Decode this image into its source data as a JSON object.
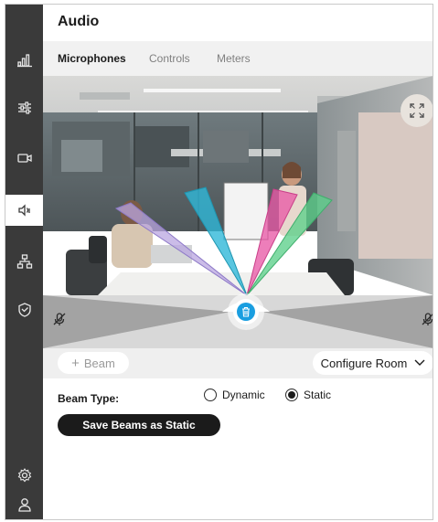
{
  "app": {
    "title": "Audio"
  },
  "tabs": [
    {
      "label": "Microphones",
      "active": true
    },
    {
      "label": "Controls",
      "active": false
    },
    {
      "label": "Meters",
      "active": false
    }
  ],
  "sidebar": {
    "items": [
      {
        "icon": "signal-bars-icon",
        "active": false
      },
      {
        "icon": "sliders-icon",
        "active": false
      },
      {
        "icon": "video-camera-icon",
        "active": false
      },
      {
        "icon": "speaker-icon",
        "active": true
      },
      {
        "icon": "network-icon",
        "active": false
      },
      {
        "icon": "shield-icon",
        "active": false
      },
      {
        "icon": "gear-icon",
        "active": false
      },
      {
        "icon": "user-icon",
        "active": false
      }
    ]
  },
  "camera": {
    "beams": [
      {
        "color": "#b9a6e0"
      },
      {
        "color": "#2fb8d8"
      },
      {
        "color": "#e85aa6"
      },
      {
        "color": "#5cd08a"
      }
    ]
  },
  "controls": {
    "beam_label": "Beam",
    "configure_label": "Configure Room"
  },
  "beam_type": {
    "label": "Beam Type:",
    "options": [
      {
        "label": "Dynamic",
        "selected": false
      },
      {
        "label": "Static",
        "selected": true
      }
    ]
  },
  "save_button": {
    "label": "Save Beams as Static"
  },
  "colors": {
    "sidebar": "#3a3a3a",
    "accent": "#1a9ee0",
    "button_dark": "#1b1b1b"
  }
}
